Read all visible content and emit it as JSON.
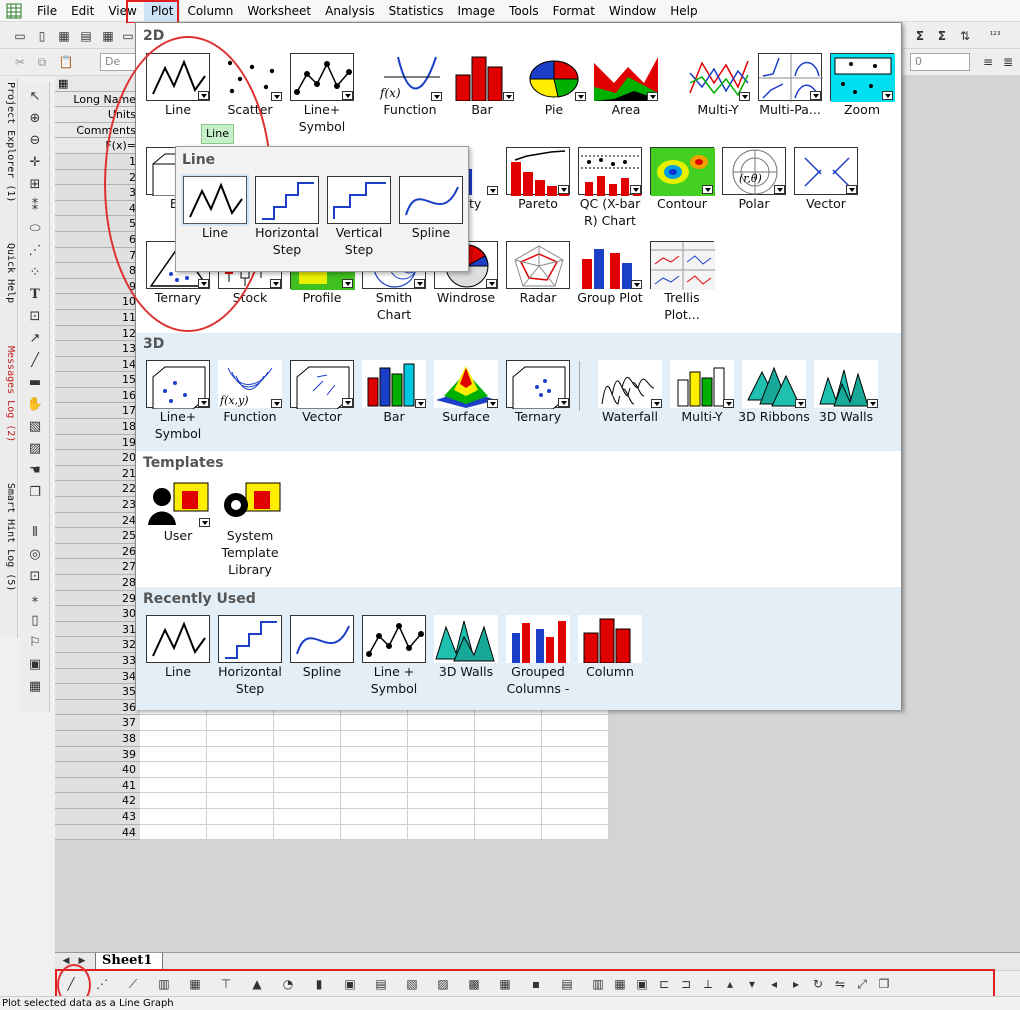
{
  "menubar": {
    "items": [
      "File",
      "Edit",
      "View",
      "Plot",
      "Column",
      "Worksheet",
      "Analysis",
      "Statistics",
      "Image",
      "Tools",
      "Format",
      "Window",
      "Help"
    ]
  },
  "toolbar": {
    "font_combo": "De",
    "size_combo": "0",
    "sum1": "Σ",
    "sum2": "Σ"
  },
  "left_dock": {
    "tabs": [
      "Project Explorer (1)",
      "Quick Help",
      "Messages Log (2)",
      "Smart Hint Log (5)"
    ]
  },
  "worksheet": {
    "header_rows": [
      "Long Name",
      "Units",
      "Comments",
      "F(x)="
    ],
    "rows": [
      "1",
      "2",
      "3",
      "4",
      "5",
      "6",
      "7",
      "8",
      "9",
      "10",
      "11",
      "12",
      "13",
      "14",
      "15",
      "16",
      "17",
      "18",
      "19",
      "20",
      "21",
      "22",
      "23",
      "24",
      "25",
      "26",
      "27",
      "28",
      "29",
      "30",
      "31",
      "32",
      "33",
      "34",
      "35",
      "36",
      "37",
      "38",
      "39",
      "40",
      "41",
      "42",
      "43",
      "44"
    ],
    "sheet_tab": "Sheet1"
  },
  "plot_menu": {
    "section_2d": "2D",
    "section_3d": "3D",
    "section_templates": "Templates",
    "section_recent": "Recently Used",
    "row1": [
      "Line",
      "Scatter",
      "Line+ Symbol",
      "Function",
      "Bar",
      "Pie",
      "Area",
      "Multi-Y",
      "Multi-Pa...",
      "Zoom"
    ],
    "row2": [
      "Bo",
      "bility",
      "Pareto",
      "QC (X-bar R) Chart",
      "Contour",
      "Polar",
      "Vector"
    ],
    "row3": [
      "Ternary",
      "Stock",
      "Profile",
      "Smith Chart",
      "Windrose",
      "Radar",
      "Group Plot",
      "Trellis Plot..."
    ],
    "row3d": [
      "Line+ Symbol",
      "Function",
      "Vector",
      "Bar",
      "Surface",
      "Ternary",
      "Waterfall",
      "Multi-Y",
      "3D Ribbons",
      "3D Walls"
    ],
    "templates": [
      "User",
      "System Template Library"
    ],
    "recent": [
      "Line",
      "Horizontal Step",
      "Spline",
      "Line + Symbol",
      "3D Walls",
      "Grouped Columns -",
      "Column"
    ]
  },
  "line_submenu": {
    "title": "Line",
    "items": [
      "Line",
      "Horizontal Step",
      "Vertical Step",
      "Spline"
    ]
  },
  "tooltip": "Line",
  "status": "Plot selected data as a Line Graph",
  "colors": {
    "highlight_red": "#e02020",
    "section_blue": "#e3eef7",
    "tooltip_green": "#c8f0c8"
  }
}
